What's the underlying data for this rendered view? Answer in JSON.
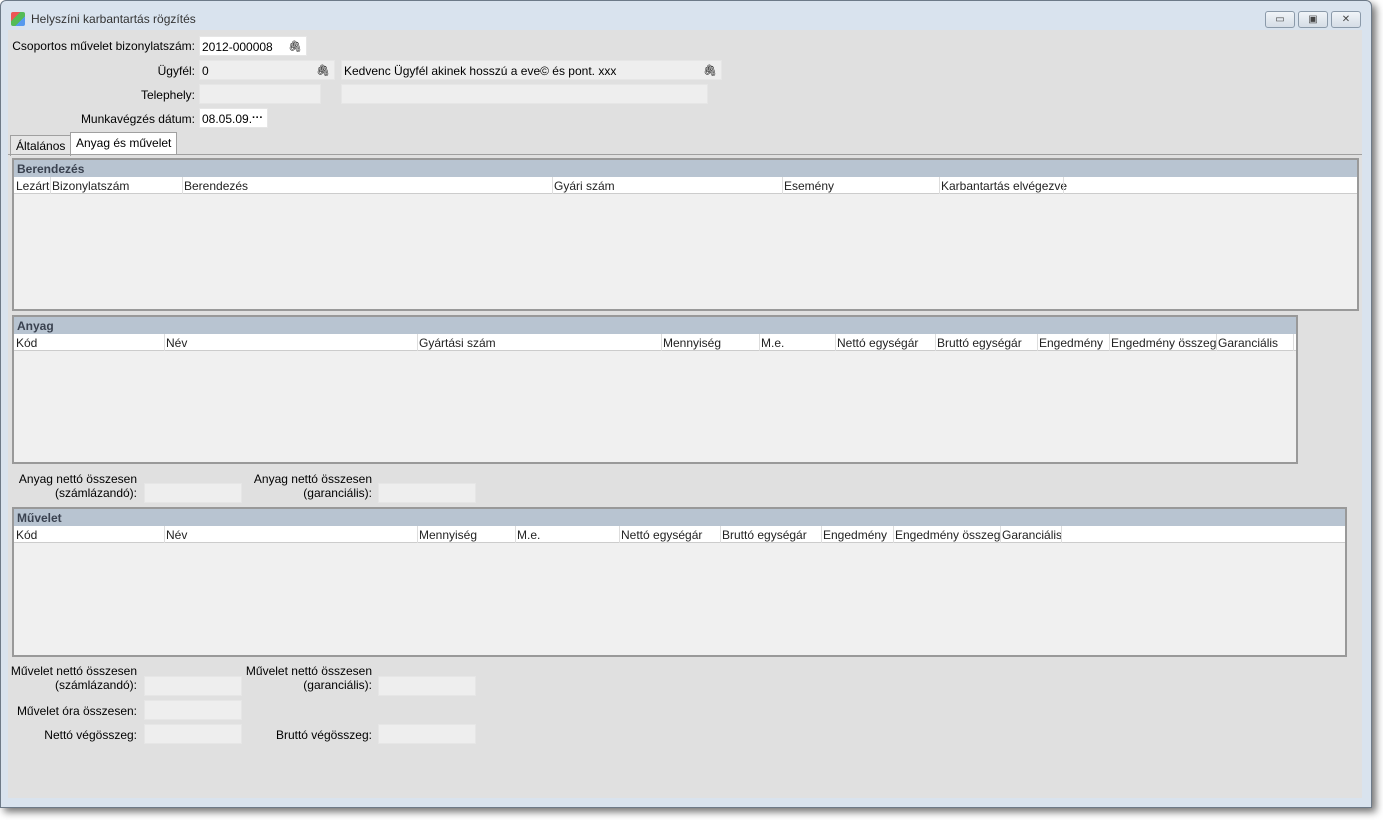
{
  "window": {
    "title": "Helyszíni karbantartás rögzítés",
    "minimize": "▭",
    "maximize": "▣",
    "close": "✕"
  },
  "form": {
    "group_doc_label": "Csoportos művelet bizonylatszám:",
    "group_doc_value": "2012-000008",
    "customer_label": "Ügyfél:",
    "customer_code": "0",
    "customer_name": "Kedvenc Ügyfél akinek hosszú a eve© és pont. xxx",
    "site_label": "Telephely:",
    "site_code": "",
    "site_name": "",
    "date_label": "Munkavégzés dátum:",
    "date_value": "08.05.09.",
    "date_button": "···",
    "clip": "🖇"
  },
  "tabs": [
    {
      "label": "Általános",
      "active": false
    },
    {
      "label": "Anyag és művelet",
      "active": true
    }
  ],
  "equipment": {
    "title": "Berendezés",
    "columns": [
      "Lezárt",
      "Bizonylatszám",
      "Berendezés",
      "Gyári szám",
      "Esemény",
      "Karbantartás elvégezve"
    ]
  },
  "material": {
    "title": "Anyag",
    "columns": [
      "Kód",
      "Név",
      "Gyártási szám",
      "Mennyiség",
      "M.e.",
      "Nettó egységár",
      "Bruttó egységár",
      "Engedmény",
      "Engedmény összeg",
      "Garanciális"
    ],
    "net_billable_label_1": "Anyag nettó összesen",
    "net_billable_label_2": "(számlázandó):",
    "net_billable": "",
    "net_warranty_label_1": "Anyag nettó összesen",
    "net_warranty_label_2": "(garanciális):",
    "net_warranty": ""
  },
  "operation": {
    "title": "Művelet",
    "columns": [
      "Kód",
      "Név",
      "Mennyiség",
      "M.e.",
      "Nettó egységár",
      "Bruttó egységár",
      "Engedmény",
      "Engedmény összeg",
      "Garanciális"
    ],
    "net_billable_label_1": "Művelet nettó összesen",
    "net_billable_label_2": "(számlázandó):",
    "net_billable": "",
    "net_warranty_label_1": "Művelet nettó összesen",
    "net_warranty_label_2": "(garanciális):",
    "net_warranty": "",
    "hours_label": "Művelet óra összesen:",
    "hours": ""
  },
  "totals": {
    "net_label": "Nettó végösszeg:",
    "net": "",
    "gross_label": "Bruttó végösszeg:",
    "gross": ""
  }
}
